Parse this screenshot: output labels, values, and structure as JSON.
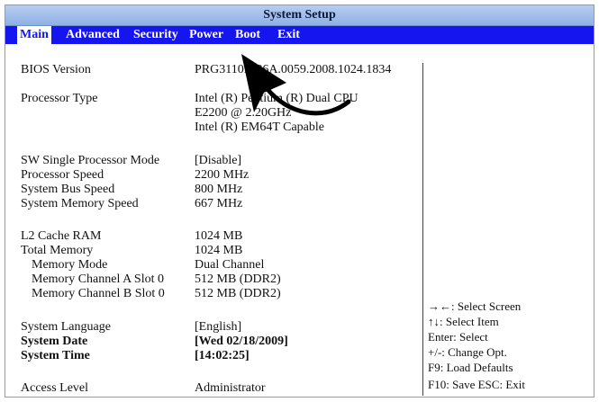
{
  "title": "System Setup",
  "menu": [
    "Main",
    "Advanced",
    "Security",
    "Power",
    "Boot",
    "Exit"
  ],
  "fields": {
    "bios_version": {
      "label": "BIOS Version",
      "value": "PRG3110H.86A.0059.2008.1024.1834"
    },
    "processor_type": {
      "label": "Processor Type",
      "value_lines": [
        "Intel (R) Pentium (R) Dual CPU",
        "E2200 @ 2.20GHz",
        "Intel  (R)  EM64T  Capable"
      ]
    },
    "sw_single": {
      "label": "SW Single Processor Mode",
      "value": "[Disable]"
    },
    "processor_speed": {
      "label": "Processor Speed",
      "value": "2200 MHz"
    },
    "bus_speed": {
      "label": "System Bus Speed",
      "value": "800 MHz"
    },
    "memory_speed": {
      "label": "System Memory Speed",
      "value": "667 MHz"
    },
    "l2_cache": {
      "label": "L2 Cache RAM",
      "value": "1024 MB"
    },
    "total_memory": {
      "label": "Total Memory",
      "value": "1024 MB"
    },
    "memory_mode": {
      "label": "Memory Mode",
      "value": "Dual Channel"
    },
    "slot_a": {
      "label": "Memory Channel A Slot 0",
      "value": "512 MB (DDR2)"
    },
    "slot_b": {
      "label": "Memory Channel B Slot 0",
      "value": "512 MB (DDR2)"
    },
    "language": {
      "label": "System Language",
      "value": "[English]"
    },
    "date": {
      "label": "System Date",
      "value": "[Wed 02/18/2009]"
    },
    "time": {
      "label": "System Time",
      "value": "[14:02:25]"
    },
    "access": {
      "label": "Access Level",
      "value": "Administrator"
    }
  },
  "help": [
    "→←: Select Screen",
    "↑↓: Select Item",
    "Enter:  Select",
    "+/-:  Change Opt.",
    "F9:  Load Defaults",
    "F10:  Save  ESC: Exit"
  ],
  "colors": {
    "menu_bg": "#1515f0",
    "title_bg": "#a6c0ec",
    "annotation_arrow": "#000000"
  }
}
